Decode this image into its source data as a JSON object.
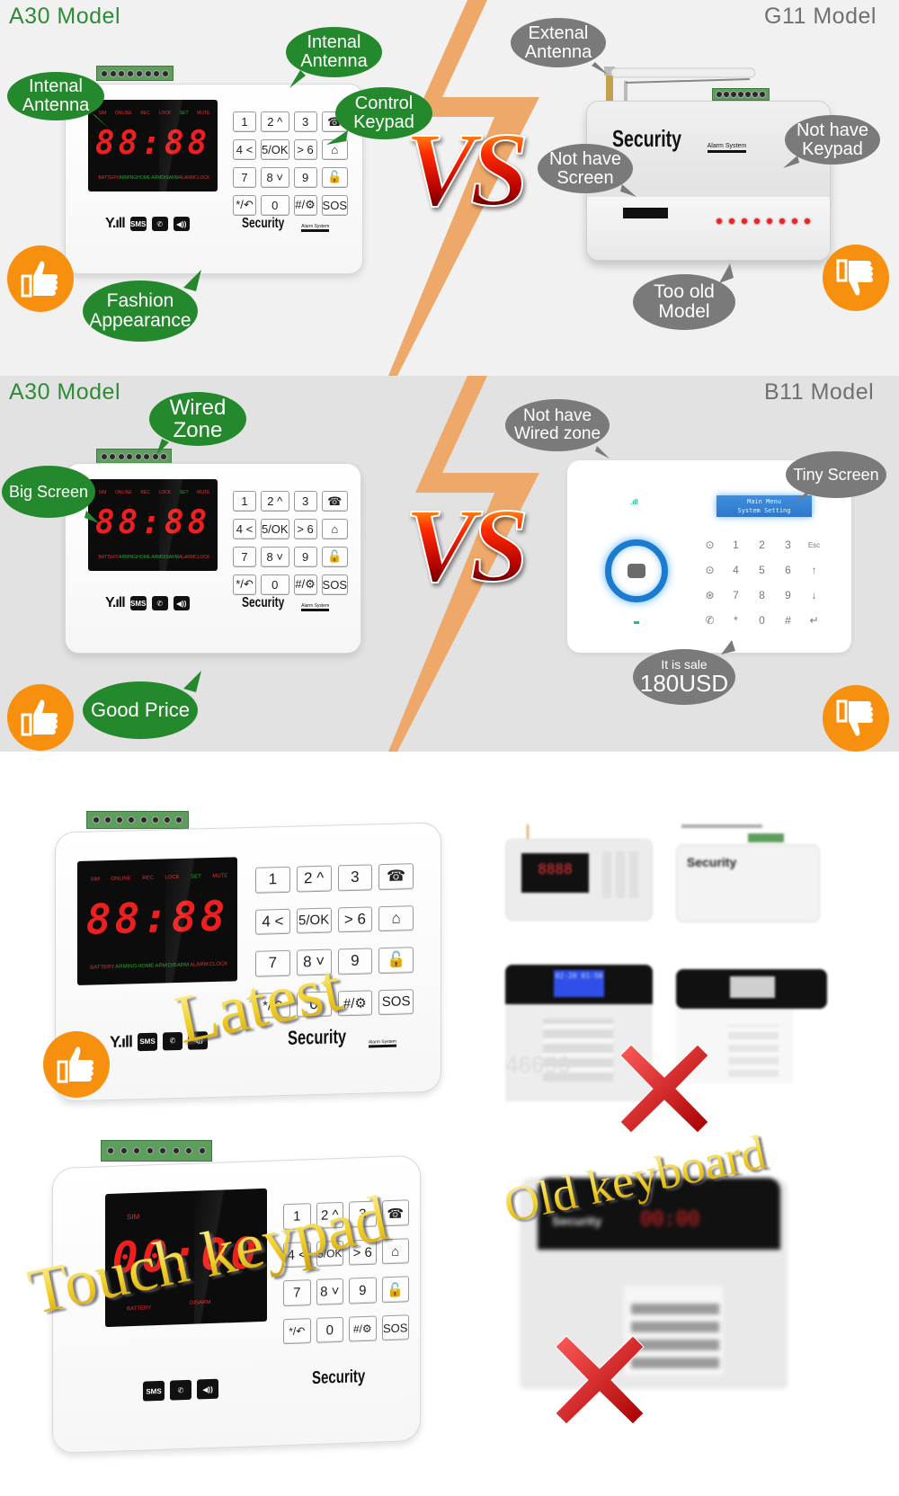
{
  "panel1": {
    "left_model": "A30 Model",
    "right_model": "G11 Model",
    "left_bubbles": [
      {
        "id": "internal-antenna-left",
        "text": "Intenal\nAntenna"
      },
      {
        "id": "internal-antenna-top",
        "text": "Intenal\nAntenna"
      },
      {
        "id": "control-keypad",
        "text": "Control\nKeypad"
      },
      {
        "id": "fashion-appearance",
        "text": "Fashion\nAppearance"
      }
    ],
    "right_bubbles": [
      {
        "id": "external-antenna",
        "text": "Extenal\nAntenna"
      },
      {
        "id": "no-screen",
        "text": "Not have\nScreen"
      },
      {
        "id": "no-keypad",
        "text": "Not have\nKeypad"
      },
      {
        "id": "too-old",
        "text": "Too old\nModel"
      }
    ],
    "vs": "VS",
    "left_verdict": "thumbs-up",
    "right_verdict": "thumbs-down"
  },
  "panel2": {
    "left_model": "A30 Model",
    "right_model": "B11 Model",
    "left_bubbles": [
      {
        "id": "wired-zone",
        "text": "Wired\nZone"
      },
      {
        "id": "big-screen",
        "text": "Big Screen"
      },
      {
        "id": "good-price",
        "text": "Good Price"
      }
    ],
    "right_bubbles": [
      {
        "id": "no-wired-zone",
        "text": "Not have\nWired zone"
      },
      {
        "id": "tiny-screen",
        "text": "Tiny Screen"
      },
      {
        "id": "price",
        "line1": "It is sale",
        "line2": "180USD"
      }
    ],
    "vs": "VS",
    "b11_lcd": [
      "Main Menu",
      "System Setting"
    ],
    "b11_keys": [
      "",
      "1",
      "2",
      "3",
      "Esc",
      "",
      "4",
      "5",
      "6",
      "↑",
      "",
      "7",
      "8",
      "9",
      "↓",
      "",
      "*",
      "0",
      "#",
      "↵"
    ],
    "left_verdict": "thumbs-up",
    "right_verdict": "thumbs-down"
  },
  "a30_device": {
    "display": "88:88",
    "status_top": [
      "SIM",
      "ONLINE",
      "REC",
      "LOCK",
      "SET",
      "MUTE"
    ],
    "status_bottom": [
      "BATTERY",
      "ARMING",
      "HOME ARM",
      "DISARM",
      "ALARM",
      "CLOCK"
    ],
    "keys": [
      "1",
      "2 ^",
      "3",
      "☎",
      "4 <",
      "5/OK",
      "> 6",
      "⌂",
      "7",
      "8 ˅",
      "9",
      "🔓",
      "*/↶",
      "0",
      "#/⚙",
      "SOS"
    ],
    "icon_labels": [
      "SMS"
    ],
    "brand": "Security",
    "brand_sub": "Alarm System"
  },
  "panel3": {
    "latest_label": "Latest",
    "touch_label": "Touch keypad",
    "old_label": "Old keyboard",
    "touch_display": "00:00",
    "touch_status": [
      "SIM",
      "BATTERY",
      "DISARM"
    ],
    "thumb1_display": "8888",
    "thumb3_display": "02-20 01-50",
    "watermark": "46656"
  },
  "colors": {
    "green_bubble": "#24892d",
    "grey_bubble": "#7a7a7a",
    "badge_orange": "#f7900e",
    "bolt": "#eea86a",
    "led_red": "#ee1f1f"
  }
}
